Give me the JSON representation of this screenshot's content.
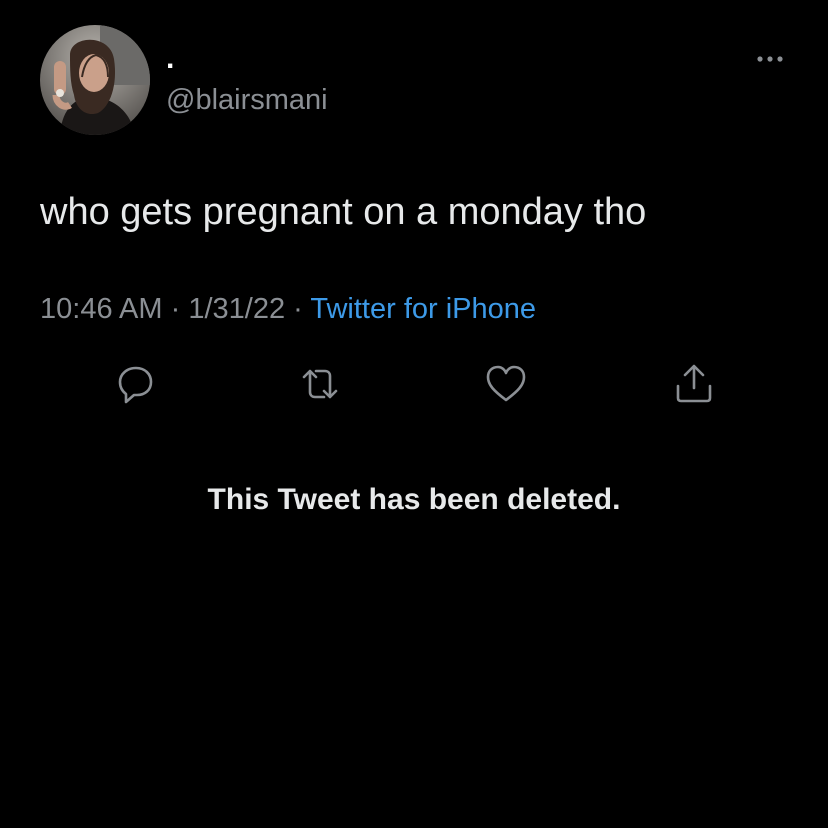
{
  "author": {
    "display_name": ".",
    "handle": "@blairsmani",
    "avatar": "profile-photo"
  },
  "header": {
    "more_icon": "more-horizontal-icon"
  },
  "tweet": {
    "text": "who gets pregnant on a monday tho",
    "time": "10:46 AM",
    "separator": "·",
    "date": "1/31/22",
    "source": "Twitter for iPhone"
  },
  "actions": {
    "reply_icon": "reply-icon",
    "retweet_icon": "retweet-icon",
    "like_icon": "heart-icon",
    "share_icon": "share-icon"
  },
  "status": {
    "deleted_text": "This Tweet has been deleted."
  },
  "colors": {
    "background": "#000000",
    "primary_text": "#e7e9ea",
    "secondary_text": "#8b8f94",
    "link": "#3d9ae8",
    "icon": "#8b8f94"
  }
}
